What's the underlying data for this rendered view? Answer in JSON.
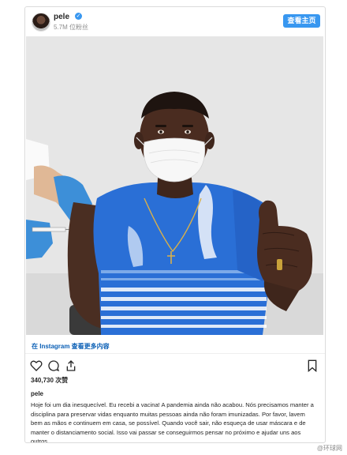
{
  "header": {
    "username": "pele",
    "followers": "5.7M 位粉丝",
    "profile_button": "查看主页",
    "verified_icon": "verified-badge-icon"
  },
  "post": {
    "view_more": "在 Instagram 查看更多内容",
    "likes": "340,730 次赞",
    "caption_user": "pele",
    "caption": "Hoje foi um dia inesquecível. Eu recebi a vacina! A pandemia ainda não acabou. Nós precisamos manter a disciplina para preservar vidas enquanto muitas pessoas ainda não foram imunizadas. Por favor, lavem bem as mãos e continuem em casa, se possível. Quando você sair, não esqueça de usar máscara e de manter o distanciamento social. Isso vai passar se conseguirmos pensar no próximo e ajudar uns aos outros."
  },
  "icons": [
    "heart-icon",
    "comment-icon",
    "share-icon",
    "bookmark-icon"
  ],
  "colors": {
    "accent": "#3897f0",
    "link": "#0a5fb5",
    "shirt": "#2a6fd6"
  },
  "watermark": "@环球网"
}
